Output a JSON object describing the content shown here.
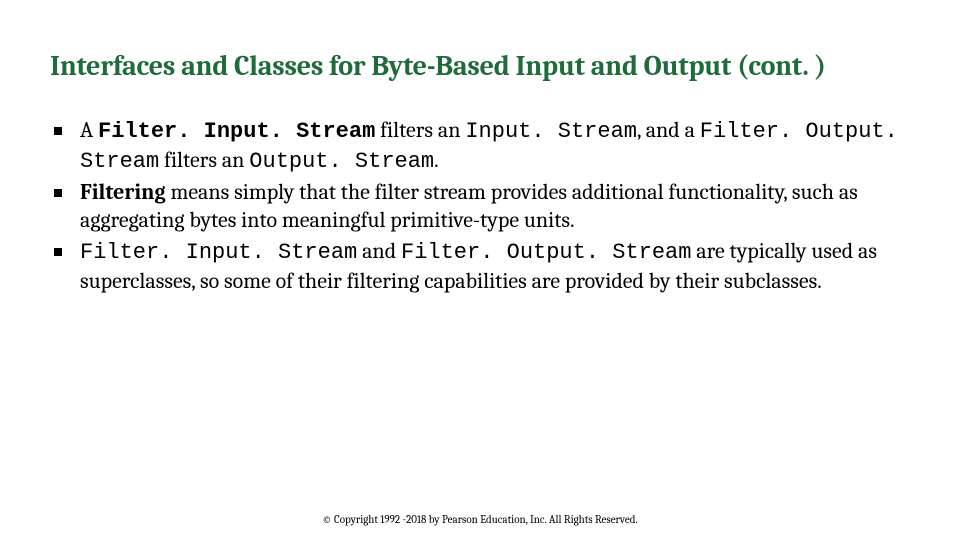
{
  "title": "Interfaces and Classes for Byte-Based Input and Output (cont. )",
  "bullets": [
    {
      "parts": [
        {
          "text": "A ",
          "cls": ""
        },
        {
          "text": "Filter. Input. Stream",
          "cls": "mono bold"
        },
        {
          "text": " filters an ",
          "cls": ""
        },
        {
          "text": "Input. Stream",
          "cls": "mono"
        },
        {
          "text": ", and a ",
          "cls": ""
        },
        {
          "text": "Filter. Output. Stream",
          "cls": "mono"
        },
        {
          "text": " filters an ",
          "cls": ""
        },
        {
          "text": "Output. Stream",
          "cls": "mono"
        },
        {
          "text": ".",
          "cls": ""
        }
      ]
    },
    {
      "parts": [
        {
          "text": "Filtering",
          "cls": "bold"
        },
        {
          "text": " means simply that the filter stream provides additional functionality, such as aggregating bytes into meaningful primitive-type units.",
          "cls": ""
        }
      ]
    },
    {
      "parts": [
        {
          "text": "Filter. Input. Stream",
          "cls": "mono"
        },
        {
          "text": " and ",
          "cls": ""
        },
        {
          "text": "Filter. Output. Stream",
          "cls": "mono"
        },
        {
          "text": " are typically used as superclasses, so some of their filtering capabilities are provided by their subclasses.",
          "cls": ""
        }
      ]
    }
  ],
  "footer": "© Copyright 1992 -2018 by Pearson Education, Inc. All Rights Reserved."
}
